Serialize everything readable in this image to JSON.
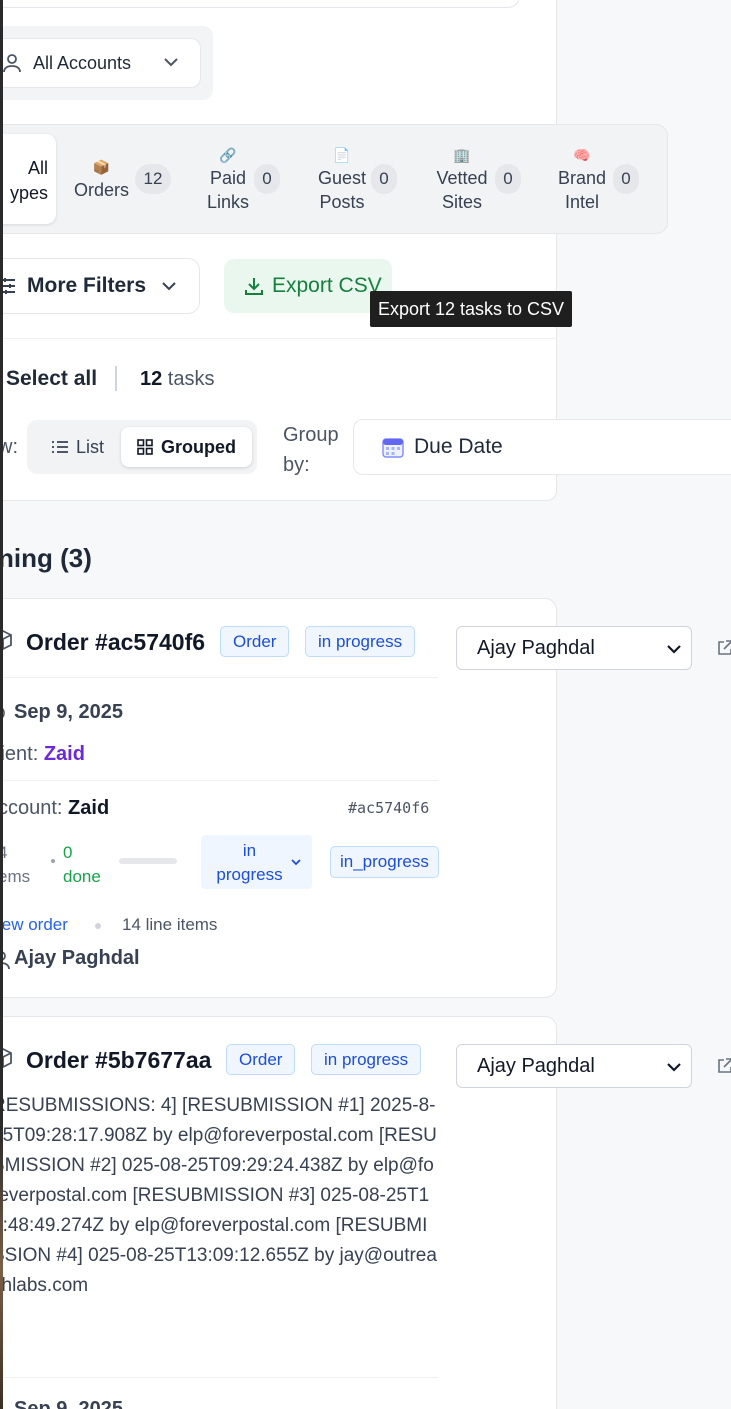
{
  "filters": {
    "account_select": "All Accounts",
    "types": {
      "all_label_line1": "All",
      "all_label_line2": "ypes",
      "items": [
        {
          "emoji": "📦",
          "label": "Orders",
          "count": "12"
        },
        {
          "emoji": "🔗",
          "label_line1": "Paid",
          "label_line2": "Links",
          "count": "0"
        },
        {
          "emoji": "📄",
          "label_line1": "Guest",
          "label_line2": "Posts",
          "count": "0"
        },
        {
          "emoji": "🏢",
          "label_line1": "Vetted",
          "label_line2": "Sites",
          "count": "0"
        },
        {
          "emoji": "🧠",
          "label_line1": "Brand",
          "label_line2": "Intel",
          "count": "0"
        }
      ]
    },
    "more_filters": "More Filters",
    "export_csv": "Export CSV",
    "export_tooltip": "Export 12 tasks to CSV"
  },
  "toolbar": {
    "select_all": "Select all",
    "tasks_count": "12",
    "tasks_word": " tasks",
    "view_label": "w:",
    "view_list": "List",
    "view_grouped": "Grouped",
    "group_by_line1": "Group",
    "group_by_line2": "by:",
    "group_by_value": "Due Date"
  },
  "section": {
    "title": "ning (3)"
  },
  "tasks": [
    {
      "title": "Order #ac5740f6",
      "type_badge": "Order",
      "status_badge": "in progress",
      "assignee_select": "Ajay Paghdal",
      "due_date": "Sep 9, 2025",
      "client_label": "lient: ",
      "client_name": "Zaid",
      "account_label": "ccount: ",
      "account_name": "Zaid",
      "hash": "#ac5740f6",
      "items_line1": "4",
      "items_line2": "ems",
      "done_line1": "0",
      "done_line2": "done",
      "progress": 0,
      "status_select_line1": "in",
      "status_select_line2": "progress",
      "status_raw": "in_progress",
      "view_order": "iew order",
      "line_items": "14 line items",
      "assignee_name": "Ajay Paghdal"
    },
    {
      "title": "Order #5b7677aa",
      "type_badge": "Order",
      "status_badge": "in progress",
      "assignee_select": "Ajay Paghdal",
      "notes": "RESUBMISSIONS: 4] [RESUBMISSION #1] 2025-8-25T09:28:17.908Z by elp@foreverpostal.com [RESUBMISSION #2] 025-08-25T09:29:24.438Z by elp@foreverpostal.com [RESUBMISSION #3] 025-08-25T11:48:49.274Z by elp@foreverpostal.com [RESUBMISSION #4] 025-08-25T13:09:12.655Z by jay@outreachlabs.com",
      "due_date_cut": "Sep 9, 2025"
    }
  ],
  "colors": {
    "accent_blue": "#1d4ed8",
    "export_green": "#15803d",
    "client_purple": "#6d28d9"
  }
}
